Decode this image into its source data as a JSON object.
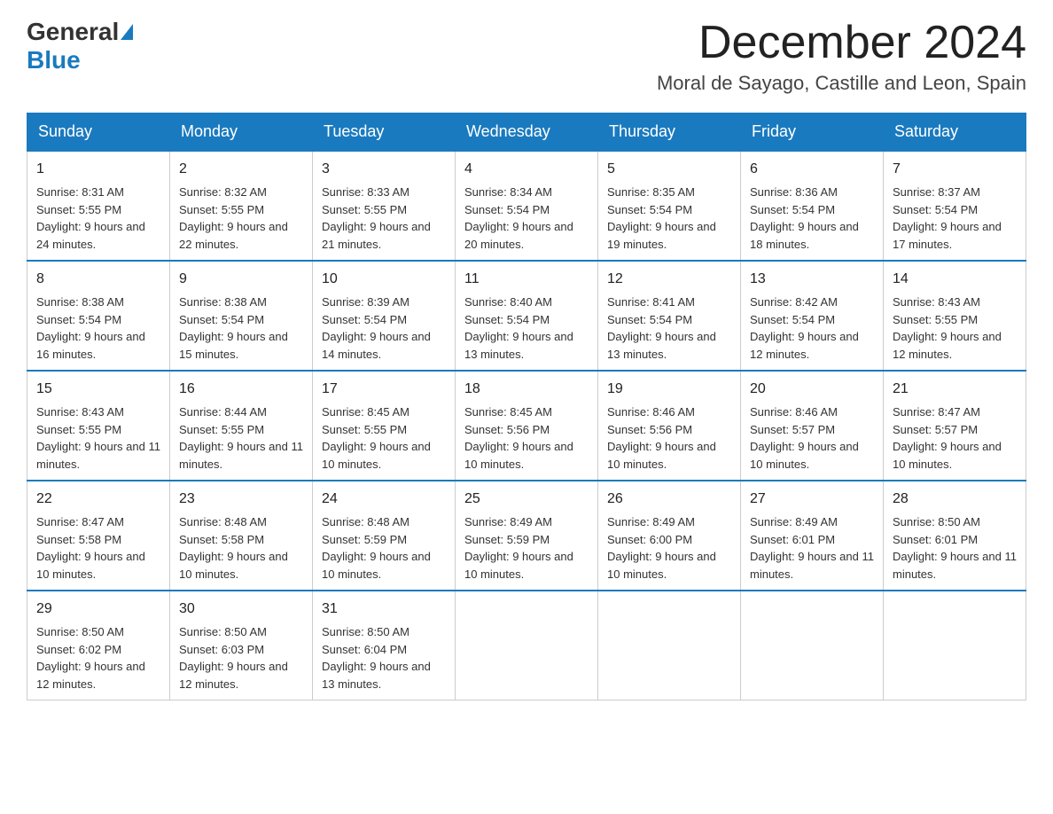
{
  "logo": {
    "general": "General",
    "blue": "Blue"
  },
  "title": {
    "month_year": "December 2024",
    "location": "Moral de Sayago, Castille and Leon, Spain"
  },
  "days_of_week": [
    "Sunday",
    "Monday",
    "Tuesday",
    "Wednesday",
    "Thursday",
    "Friday",
    "Saturday"
  ],
  "weeks": [
    [
      {
        "day": "1",
        "sunrise": "8:31 AM",
        "sunset": "5:55 PM",
        "daylight": "9 hours and 24 minutes."
      },
      {
        "day": "2",
        "sunrise": "8:32 AM",
        "sunset": "5:55 PM",
        "daylight": "9 hours and 22 minutes."
      },
      {
        "day": "3",
        "sunrise": "8:33 AM",
        "sunset": "5:55 PM",
        "daylight": "9 hours and 21 minutes."
      },
      {
        "day": "4",
        "sunrise": "8:34 AM",
        "sunset": "5:54 PM",
        "daylight": "9 hours and 20 minutes."
      },
      {
        "day": "5",
        "sunrise": "8:35 AM",
        "sunset": "5:54 PM",
        "daylight": "9 hours and 19 minutes."
      },
      {
        "day": "6",
        "sunrise": "8:36 AM",
        "sunset": "5:54 PM",
        "daylight": "9 hours and 18 minutes."
      },
      {
        "day": "7",
        "sunrise": "8:37 AM",
        "sunset": "5:54 PM",
        "daylight": "9 hours and 17 minutes."
      }
    ],
    [
      {
        "day": "8",
        "sunrise": "8:38 AM",
        "sunset": "5:54 PM",
        "daylight": "9 hours and 16 minutes."
      },
      {
        "day": "9",
        "sunrise": "8:38 AM",
        "sunset": "5:54 PM",
        "daylight": "9 hours and 15 minutes."
      },
      {
        "day": "10",
        "sunrise": "8:39 AM",
        "sunset": "5:54 PM",
        "daylight": "9 hours and 14 minutes."
      },
      {
        "day": "11",
        "sunrise": "8:40 AM",
        "sunset": "5:54 PM",
        "daylight": "9 hours and 13 minutes."
      },
      {
        "day": "12",
        "sunrise": "8:41 AM",
        "sunset": "5:54 PM",
        "daylight": "9 hours and 13 minutes."
      },
      {
        "day": "13",
        "sunrise": "8:42 AM",
        "sunset": "5:54 PM",
        "daylight": "9 hours and 12 minutes."
      },
      {
        "day": "14",
        "sunrise": "8:43 AM",
        "sunset": "5:55 PM",
        "daylight": "9 hours and 12 minutes."
      }
    ],
    [
      {
        "day": "15",
        "sunrise": "8:43 AM",
        "sunset": "5:55 PM",
        "daylight": "9 hours and 11 minutes."
      },
      {
        "day": "16",
        "sunrise": "8:44 AM",
        "sunset": "5:55 PM",
        "daylight": "9 hours and 11 minutes."
      },
      {
        "day": "17",
        "sunrise": "8:45 AM",
        "sunset": "5:55 PM",
        "daylight": "9 hours and 10 minutes."
      },
      {
        "day": "18",
        "sunrise": "8:45 AM",
        "sunset": "5:56 PM",
        "daylight": "9 hours and 10 minutes."
      },
      {
        "day": "19",
        "sunrise": "8:46 AM",
        "sunset": "5:56 PM",
        "daylight": "9 hours and 10 minutes."
      },
      {
        "day": "20",
        "sunrise": "8:46 AM",
        "sunset": "5:57 PM",
        "daylight": "9 hours and 10 minutes."
      },
      {
        "day": "21",
        "sunrise": "8:47 AM",
        "sunset": "5:57 PM",
        "daylight": "9 hours and 10 minutes."
      }
    ],
    [
      {
        "day": "22",
        "sunrise": "8:47 AM",
        "sunset": "5:58 PM",
        "daylight": "9 hours and 10 minutes."
      },
      {
        "day": "23",
        "sunrise": "8:48 AM",
        "sunset": "5:58 PM",
        "daylight": "9 hours and 10 minutes."
      },
      {
        "day": "24",
        "sunrise": "8:48 AM",
        "sunset": "5:59 PM",
        "daylight": "9 hours and 10 minutes."
      },
      {
        "day": "25",
        "sunrise": "8:49 AM",
        "sunset": "5:59 PM",
        "daylight": "9 hours and 10 minutes."
      },
      {
        "day": "26",
        "sunrise": "8:49 AM",
        "sunset": "6:00 PM",
        "daylight": "9 hours and 10 minutes."
      },
      {
        "day": "27",
        "sunrise": "8:49 AM",
        "sunset": "6:01 PM",
        "daylight": "9 hours and 11 minutes."
      },
      {
        "day": "28",
        "sunrise": "8:50 AM",
        "sunset": "6:01 PM",
        "daylight": "9 hours and 11 minutes."
      }
    ],
    [
      {
        "day": "29",
        "sunrise": "8:50 AM",
        "sunset": "6:02 PM",
        "daylight": "9 hours and 12 minutes."
      },
      {
        "day": "30",
        "sunrise": "8:50 AM",
        "sunset": "6:03 PM",
        "daylight": "9 hours and 12 minutes."
      },
      {
        "day": "31",
        "sunrise": "8:50 AM",
        "sunset": "6:04 PM",
        "daylight": "9 hours and 13 minutes."
      },
      null,
      null,
      null,
      null
    ]
  ]
}
